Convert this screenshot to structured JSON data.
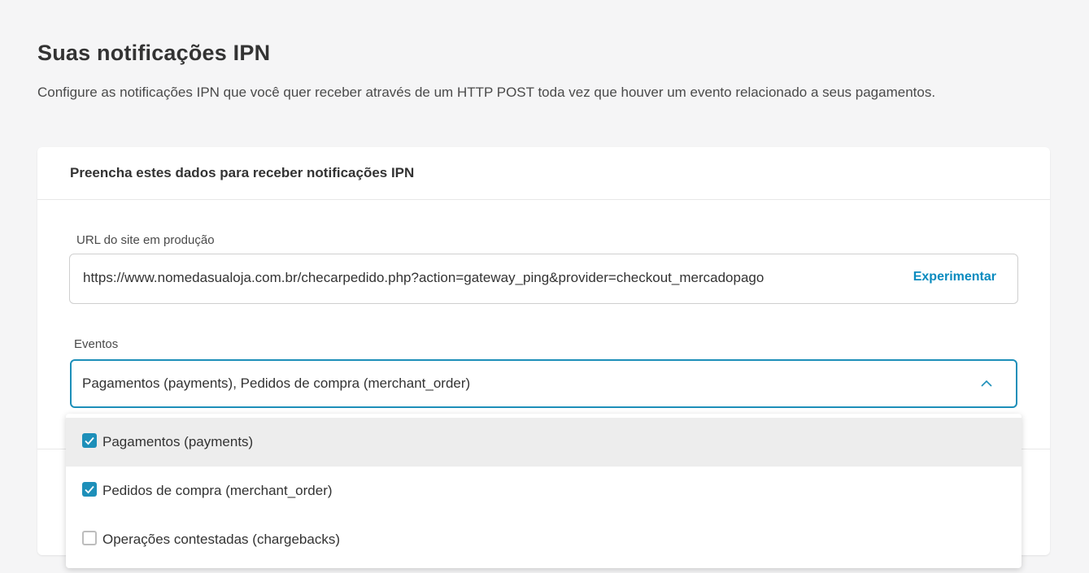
{
  "page": {
    "title": "Suas notificações IPN",
    "description": "Configure as notificações IPN que você quer receber através de um HTTP POST toda vez que houver um evento relacionado a seus pagamentos."
  },
  "form": {
    "header": "Preencha estes dados para receber notificações IPN",
    "url_label": "URL do site em produção",
    "url_value": "https://www.nomedasualoja.com.br/checarpedido.php?action=gateway_ping&provider=checkout_mercadopago",
    "try_label": "Experimentar",
    "events_label": "Eventos",
    "events_selected": "Pagamentos (payments), Pedidos de compra (merchant_order)",
    "events_options": [
      {
        "label": "Pagamentos (payments)",
        "checked": true
      },
      {
        "label": "Pedidos de compra (merchant_order)",
        "checked": true
      },
      {
        "label": "Operações contestadas (chargebacks)",
        "checked": false
      }
    ]
  },
  "colors": {
    "accent": "#1d8fb9",
    "link": "#0a8bbf",
    "background": "#f5f5f6"
  },
  "icons": {
    "select_toggle": "chevron-up-icon",
    "checked": "checkbox-checked-icon",
    "unchecked": "checkbox-empty-icon"
  }
}
